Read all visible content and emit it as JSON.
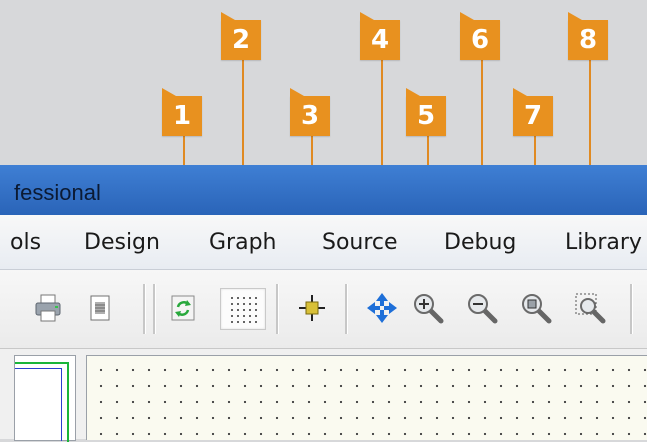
{
  "window": {
    "title": "fessional"
  },
  "menu": {
    "items": [
      {
        "label": "ols"
      },
      {
        "label": "Design"
      },
      {
        "label": "Graph"
      },
      {
        "label": "Source"
      },
      {
        "label": "Debug"
      },
      {
        "label": "Library"
      }
    ]
  },
  "callouts": [
    "1",
    "2",
    "3",
    "4",
    "5",
    "6",
    "7",
    "8"
  ],
  "toolbar": {
    "icons": [
      "print-icon",
      "document-icon",
      "refresh-icon",
      "grid-toggle-icon",
      "origin-icon",
      "pan-icon",
      "zoom-in-icon",
      "zoom-out-icon",
      "zoom-all-icon",
      "zoom-area-icon"
    ]
  },
  "colors": {
    "callout": "#e8911f",
    "titlebar": "#2f6fc7",
    "grid_bg": "#fafaf0"
  }
}
